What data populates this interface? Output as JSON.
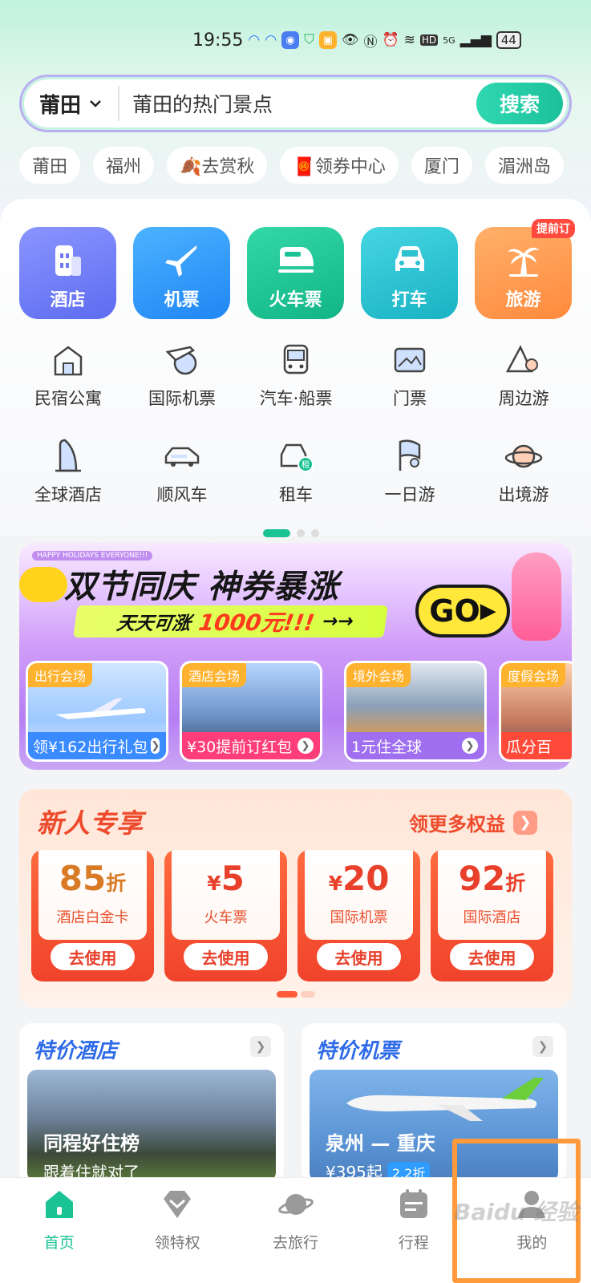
{
  "status": {
    "time": "19:55",
    "network": "HD",
    "signal": "5G",
    "battery": "44"
  },
  "search": {
    "city": "莆田",
    "placeholder": "莆田的热门景点",
    "button": "搜索"
  },
  "chips": [
    "莆田",
    "福州",
    "🍂去赏秋",
    "🧧领券中心",
    "厦门",
    "湄洲岛"
  ],
  "main_services": [
    {
      "label": "酒店",
      "icon": "hotel-icon",
      "color": "#6e7bf5"
    },
    {
      "label": "机票",
      "icon": "plane-icon",
      "color": "#2f9bff"
    },
    {
      "label": "火车票",
      "icon": "train-icon",
      "color": "#19c393"
    },
    {
      "label": "打车",
      "icon": "car-icon",
      "color": "#2ec1cf"
    },
    {
      "label": "旅游",
      "icon": "palm-icon",
      "color": "#ff9a4a",
      "badge": "提前订"
    }
  ],
  "services_row1": [
    {
      "label": "民宿公寓",
      "icon": "homestay-icon"
    },
    {
      "label": "国际机票",
      "icon": "globe-plane-icon"
    },
    {
      "label": "汽车·船票",
      "icon": "bus-icon"
    },
    {
      "label": "门票",
      "icon": "ticket-icon"
    },
    {
      "label": "周边游",
      "icon": "mountain-pin-icon"
    }
  ],
  "services_row2": [
    {
      "label": "全球酒店",
      "icon": "tower-hotel-icon"
    },
    {
      "label": "顺风车",
      "icon": "rideshare-icon"
    },
    {
      "label": "租车",
      "icon": "rental-car-icon"
    },
    {
      "label": "一日游",
      "icon": "flag-icon"
    },
    {
      "label": "出境游",
      "icon": "planet-icon"
    }
  ],
  "banner": {
    "head": "HAPPY HOLIDAYS EVERYONE!!!",
    "title": "双节同庆 神券暴涨",
    "sub_prefix": "天天可涨",
    "sub_amount": "1000元!!!",
    "sub_arrows": "→→",
    "go": "GO",
    "venues": [
      {
        "tag": "出行会场",
        "bar": "领¥162出行礼包",
        "color": "#3a8bff"
      },
      {
        "tag": "酒店会场",
        "bar": "¥30提前订红包",
        "color": "#ff3d7a"
      },
      {
        "tag": "境外会场",
        "bar": "1元住全球",
        "color": "#a06ff0"
      },
      {
        "tag": "度假会场",
        "bar": "瓜分百",
        "color": "#ff4a3a"
      }
    ]
  },
  "newcomer": {
    "title": "新人专享",
    "more": "领更多权益",
    "coupons": [
      {
        "amount": "85",
        "unit": "折",
        "prefix": "",
        "desc": "酒店白金卡",
        "use": "去使用",
        "color": "#d97b25"
      },
      {
        "amount": "5",
        "unit": "",
        "prefix": "¥",
        "desc": "火车票",
        "use": "去使用",
        "color": "#e8402a"
      },
      {
        "amount": "20",
        "unit": "",
        "prefix": "¥",
        "desc": "国际机票",
        "use": "去使用",
        "color": "#e8402a"
      },
      {
        "amount": "92",
        "unit": "折",
        "prefix": "",
        "desc": "国际酒店",
        "use": "去使用",
        "color": "#e8402a"
      }
    ]
  },
  "deals": [
    {
      "title": "特价酒店",
      "caption": "同程好住榜",
      "sub": "跟着住就对了"
    },
    {
      "title": "特价机票",
      "caption": "泉州 — 重庆",
      "sub": "¥395起",
      "discount": "2.2折"
    }
  ],
  "tabs": [
    {
      "label": "首页",
      "icon": "home-icon",
      "active": true
    },
    {
      "label": "领特权",
      "icon": "diamond-icon",
      "active": false
    },
    {
      "label": "去旅行",
      "icon": "planet-icon",
      "active": false
    },
    {
      "label": "行程",
      "icon": "calendar-icon",
      "active": false
    },
    {
      "label": "我的",
      "icon": "user-icon",
      "active": false
    }
  ],
  "watermark": "Baidu 经验"
}
